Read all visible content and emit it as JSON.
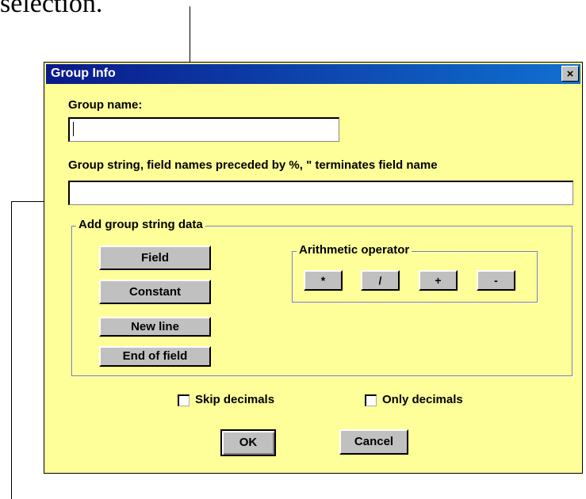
{
  "caption": "selection.",
  "window": {
    "title": "Group Info",
    "close_label": "×"
  },
  "group_name": {
    "label": "Group name:",
    "value": ""
  },
  "group_string": {
    "label": "Group string, field names preceded by %, \" terminates field name",
    "value": ""
  },
  "add_data": {
    "title": "Add group string data",
    "buttons": {
      "field": "Field",
      "constant": "Constant",
      "new_line": "New line",
      "end_of_field": "End of field"
    },
    "arithmetic": {
      "title": "Arithmetic operator",
      "multiply": "*",
      "divide": "/",
      "plus": "+",
      "minus": "-"
    }
  },
  "options": {
    "skip_decimals": {
      "label": "Skip decimals",
      "checked": false
    },
    "only_decimals": {
      "label": "Only decimals",
      "checked": false
    }
  },
  "actions": {
    "ok": "OK",
    "cancel": "Cancel"
  }
}
